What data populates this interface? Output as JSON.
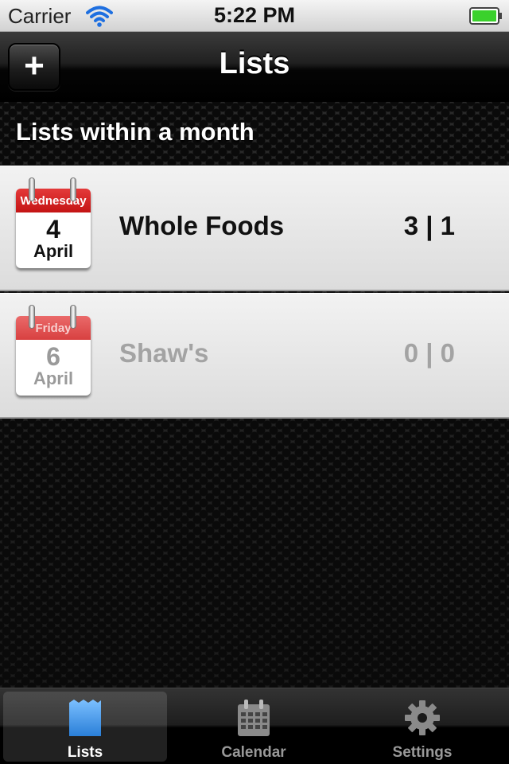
{
  "status_bar": {
    "carrier": "Carrier",
    "time": "5:22 PM",
    "wifi_icon": "wifi-icon",
    "battery_icon": "battery-icon"
  },
  "nav": {
    "title": "Lists",
    "add_label": "+"
  },
  "section": {
    "header": "Lists within a month"
  },
  "lists": [
    {
      "weekday": "Wednesday",
      "day": "4",
      "month": "April",
      "name": "Whole Foods",
      "counts": "3 | 1",
      "dimmed": false
    },
    {
      "weekday": "Friday",
      "day": "6",
      "month": "April",
      "name": "Shaw's",
      "counts": "0 | 0",
      "dimmed": true
    }
  ],
  "tabs": [
    {
      "label": "Lists",
      "icon": "list-icon",
      "selected": true
    },
    {
      "label": "Calendar",
      "icon": "calendar-icon",
      "selected": false
    },
    {
      "label": "Settings",
      "icon": "gear-icon",
      "selected": false
    }
  ],
  "colors": {
    "calendar_red": "#d42020",
    "battery_green": "#3ad12c",
    "lists_tab_blue": "#3b8fe0"
  }
}
